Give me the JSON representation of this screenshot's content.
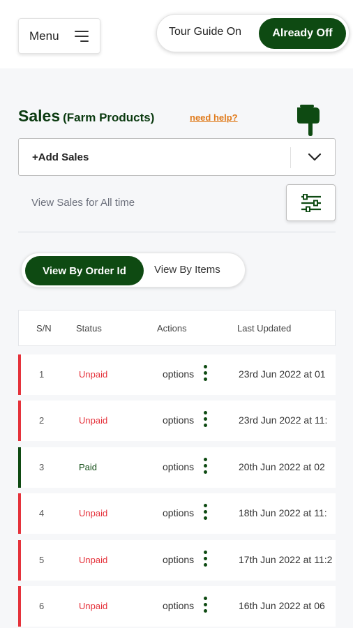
{
  "header": {
    "menu_label": "Menu",
    "tour_on_label": "Tour Guide On",
    "tour_off_label": "Already Off"
  },
  "sales": {
    "title": "Sales",
    "subtitle": "(Farm Products)",
    "help_label": "need help?",
    "add_label": "+Add Sales",
    "view_time_label": "View Sales for All time"
  },
  "view_toggle": {
    "by_order": "View By Order Id",
    "by_items": "View By Items"
  },
  "table": {
    "headers": [
      "S/N",
      "Status",
      "Actions",
      "Last Updated"
    ],
    "rows": [
      {
        "sn": "1",
        "status": "Unpaid",
        "action": "options",
        "updated": "23rd Jun 2022 at 01"
      },
      {
        "sn": "2",
        "status": "Unpaid",
        "action": "options",
        "updated": "23rd Jun 2022 at 11:"
      },
      {
        "sn": "3",
        "status": "Paid",
        "action": "options",
        "updated": "20th Jun 2022 at 02"
      },
      {
        "sn": "4",
        "status": "Unpaid",
        "action": "options",
        "updated": "18th Jun 2022 at 11:"
      },
      {
        "sn": "5",
        "status": "Unpaid",
        "action": "options",
        "updated": "17th Jun 2022 at 11:2"
      },
      {
        "sn": "6",
        "status": "Unpaid",
        "action": "options",
        "updated": "16th Jun 2022 at 06"
      }
    ]
  },
  "colors": {
    "brand_green": "#0e4a12",
    "title_green": "#0b3a10",
    "help_orange": "#e07b1c",
    "unpaid_red": "#e5323b",
    "paid_green": "#0e4a12"
  },
  "icons": {
    "menu": "hamburger-icon",
    "help_pointer": "pointing-hand-icon",
    "dropdown": "chevron-down-icon",
    "filter": "sliders-icon",
    "row_menu": "vertical-dots-icon"
  }
}
